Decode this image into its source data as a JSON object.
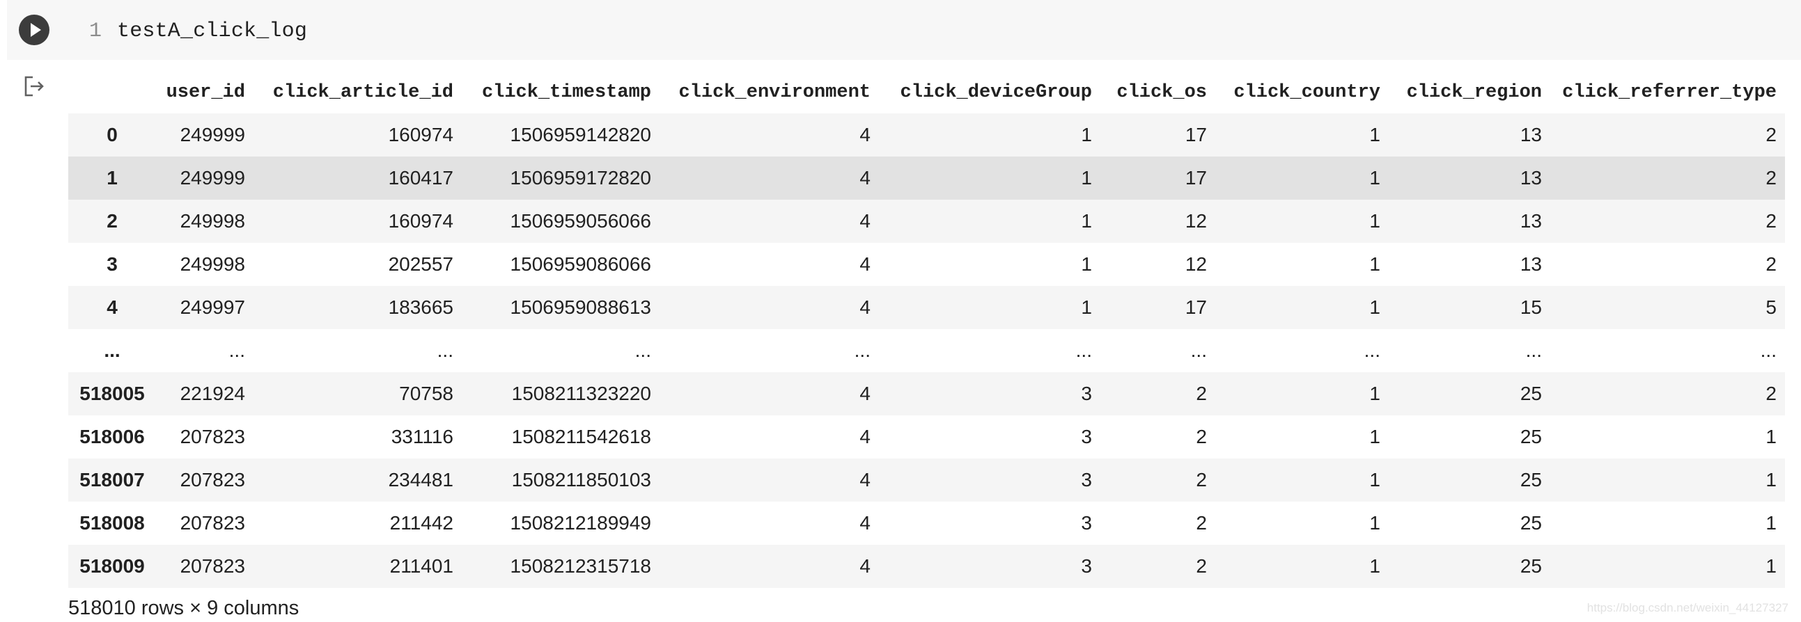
{
  "cell": {
    "line_number": "1",
    "code": "testA_click_log"
  },
  "table": {
    "columns": [
      "",
      "user_id",
      "click_article_id",
      "click_timestamp",
      "click_environment",
      "click_deviceGroup",
      "click_os",
      "click_country",
      "click_region",
      "click_referrer_type"
    ],
    "rows": [
      {
        "index": "0",
        "cells": [
          "249999",
          "160974",
          "1506959142820",
          "4",
          "1",
          "17",
          "1",
          "13",
          "2"
        ]
      },
      {
        "index": "1",
        "cells": [
          "249999",
          "160417",
          "1506959172820",
          "4",
          "1",
          "17",
          "1",
          "13",
          "2"
        ]
      },
      {
        "index": "2",
        "cells": [
          "249998",
          "160974",
          "1506959056066",
          "4",
          "1",
          "12",
          "1",
          "13",
          "2"
        ]
      },
      {
        "index": "3",
        "cells": [
          "249998",
          "202557",
          "1506959086066",
          "4",
          "1",
          "12",
          "1",
          "13",
          "2"
        ]
      },
      {
        "index": "4",
        "cells": [
          "249997",
          "183665",
          "1506959088613",
          "4",
          "1",
          "17",
          "1",
          "15",
          "5"
        ]
      },
      {
        "index": "...",
        "cells": [
          "...",
          "...",
          "...",
          "...",
          "...",
          "...",
          "...",
          "...",
          "..."
        ]
      },
      {
        "index": "518005",
        "cells": [
          "221924",
          "70758",
          "1508211323220",
          "4",
          "3",
          "2",
          "1",
          "25",
          "2"
        ]
      },
      {
        "index": "518006",
        "cells": [
          "207823",
          "331116",
          "1508211542618",
          "4",
          "3",
          "2",
          "1",
          "25",
          "1"
        ]
      },
      {
        "index": "518007",
        "cells": [
          "207823",
          "234481",
          "1508211850103",
          "4",
          "3",
          "2",
          "1",
          "25",
          "1"
        ]
      },
      {
        "index": "518008",
        "cells": [
          "207823",
          "211442",
          "1508212189949",
          "4",
          "3",
          "2",
          "1",
          "25",
          "1"
        ]
      },
      {
        "index": "518009",
        "cells": [
          "207823",
          "211401",
          "1508212315718",
          "4",
          "3",
          "2",
          "1",
          "25",
          "1"
        ]
      }
    ],
    "hovered_row": "1"
  },
  "shape_text": "518010 rows × 9 columns",
  "watermark": "https://blog.csdn.net/weixin_44127327",
  "icons": {
    "run": "play-circle-icon",
    "output": "output-redirect-icon"
  },
  "colors": {
    "cell_background": "#f7f7f7",
    "run_button": "#3c3c3c",
    "row_stripe": "#f5f5f5",
    "row_hover": "#e2e2e2"
  }
}
